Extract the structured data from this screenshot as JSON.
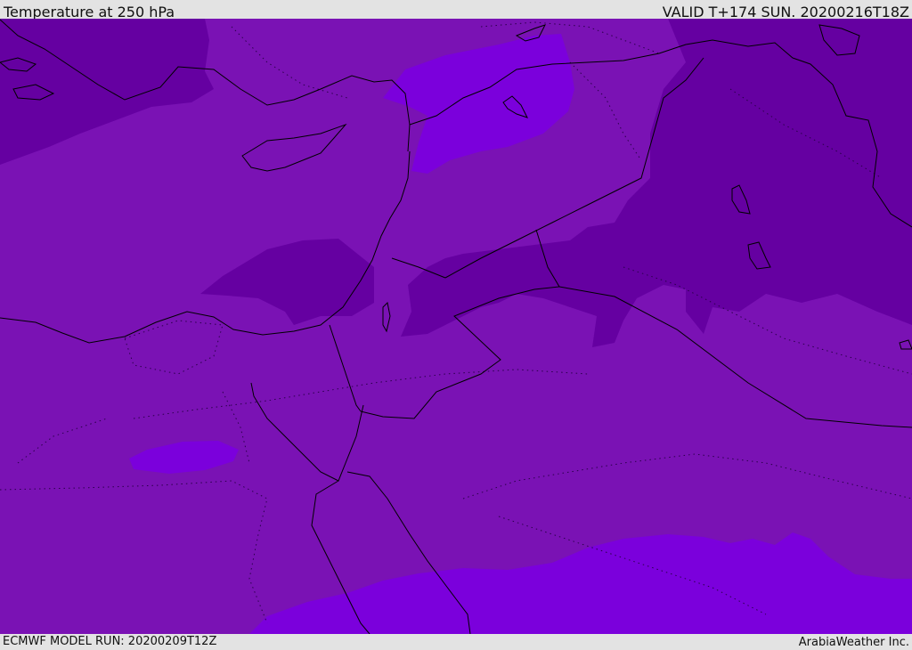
{
  "header": {
    "title": "Temperature at 250 hPa",
    "valid": "VALID T+174 SUN. 20200216T18Z"
  },
  "footer": {
    "model_run": "ECMWF MODEL RUN: 20200209T12Z",
    "credit": "ArabiaWeather Inc."
  },
  "map": {
    "colors": {
      "base": "#7a12b4",
      "cold": "#6500a1",
      "warm": "#7b00dc",
      "outline": "#000000"
    }
  }
}
